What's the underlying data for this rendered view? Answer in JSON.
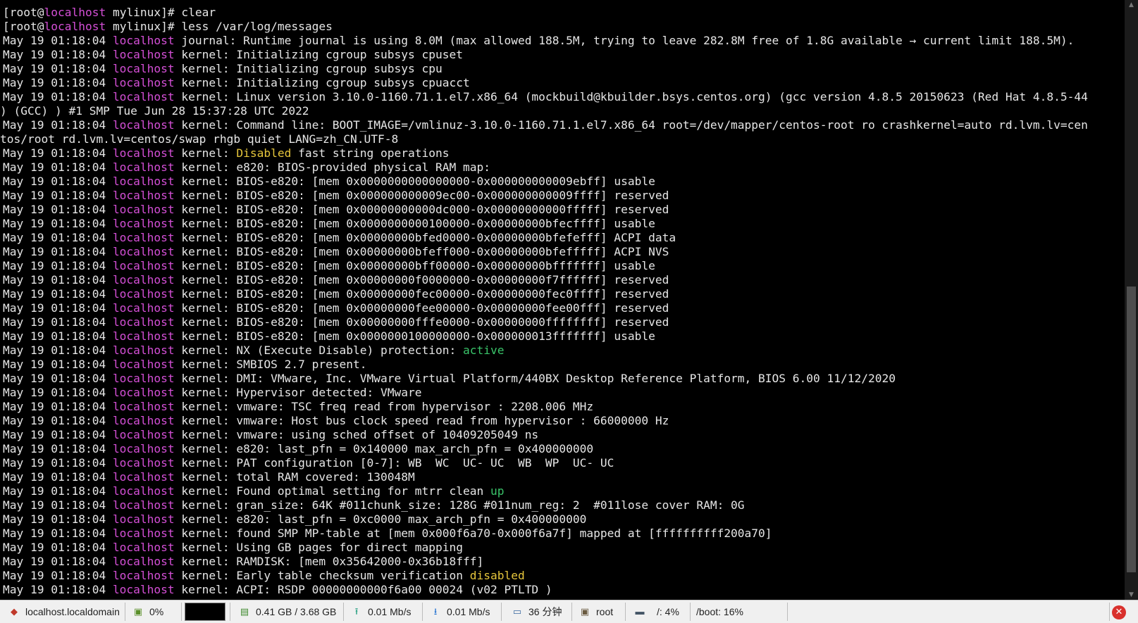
{
  "terminal": {
    "prompt_user": "[root@",
    "prompt_host": "localhost",
    "prompt_dir": " mylinux]# ",
    "cmd1": "clear",
    "cmd2": "less /var/log/messages",
    "ts": "May 19 01:18:04 ",
    "host": "localhost",
    "lines": [
      [
        "journal: Runtime journal is using 8.0M (max ",
        "allowed",
        " 188.5M, trying to leave 282.8M free of 1.8G available → current limit 188.5M)."
      ],
      [
        "kernel: Initializing cgroup subsys cpuset"
      ],
      [
        "kernel: Initializing cgroup subsys cpu"
      ],
      [
        "kernel: Initializing cgroup subsys cpuacct"
      ],
      [
        "kernel: Linux version 3.10.0-1160.71.1.el7.x86_64 (mockbuild@kbuilder.bsys.centos.org) (gcc version 4.8.5 20150623 (Red Hat 4.8.5-44"
      ],
      [
        "kernel: Command line: BOOT_IMAGE=/vmlinuz-3.10.0-1160.71.1.el7.x86_64 root=/dev/mapper/centos-root ro crashkernel=auto rd.lvm.lv=cen"
      ],
      [
        "kernel: ",
        "Disabled",
        " fast string operations"
      ],
      [
        "kernel: e820: BIOS-provided physical RAM map:"
      ],
      [
        "kernel: BIOS-e820: [mem 0x0000000000000000-0x000000000009ebff] usable"
      ],
      [
        "kernel: BIOS-e820: [mem 0x000000000009ec00-0x000000000009ffff] reserved"
      ],
      [
        "kernel: BIOS-e820: [mem 0x00000000000dc000-0x00000000000fffff] reserved"
      ],
      [
        "kernel: BIOS-e820: [mem 0x0000000000100000-0x00000000bfecffff] usable"
      ],
      [
        "kernel: BIOS-e820: [mem 0x00000000bfed0000-0x00000000bfefefff] ACPI data"
      ],
      [
        "kernel: BIOS-e820: [mem 0x00000000bfeff000-0x00000000bfefffff] ACPI NVS"
      ],
      [
        "kernel: BIOS-e820: [mem 0x00000000bff00000-0x00000000bfffffff] usable"
      ],
      [
        "kernel: BIOS-e820: [mem 0x00000000f0000000-0x00000000f7ffffff] reserved"
      ],
      [
        "kernel: BIOS-e820: [mem 0x00000000fec00000-0x00000000fec0ffff] reserved"
      ],
      [
        "kernel: BIOS-e820: [mem 0x00000000fee00000-0x00000000fee00fff] reserved"
      ],
      [
        "kernel: BIOS-e820: [mem 0x00000000fffe0000-0x00000000ffffffff] reserved"
      ],
      [
        "kernel: BIOS-e820: [mem 0x0000000100000000-0x000000013fffffff] usable"
      ],
      [
        "kernel: NX (Execute Disable) protection: ",
        "active",
        ""
      ],
      [
        "kernel: SMBIOS 2.7 present."
      ],
      [
        "kernel: DMI: VMware, Inc. VMware Virtual Platform/440BX Desktop Reference Platform, BIOS 6.00 11/12/2020"
      ],
      [
        "kernel: Hypervisor detected: VMware"
      ],
      [
        "kernel: vmware: TSC freq read from hypervisor : 2208.006 MHz"
      ],
      [
        "kernel: vmware: Host bus clock speed read from hypervisor : 66000000 Hz"
      ],
      [
        "kernel: vmware: using sched offset of 10409205049 ns"
      ],
      [
        "kernel: e820: last_pfn = 0x140000 max_arch_pfn = 0x400000000"
      ],
      [
        "kernel: PAT configuration [0-7]: WB  WC  UC- UC  WB  WP  UC- UC"
      ],
      [
        "kernel: total RAM covered: 130048M"
      ],
      [
        "kernel: Found optimal setting for mtrr clean ",
        "up",
        ""
      ],
      [
        "kernel: gran_size: 64K #011chunk_size: 128G #011num_reg: 2  #011lose cover RAM: 0G"
      ],
      [
        "kernel: e820: last_pfn = 0xc0000 max_arch_pfn = 0x400000000"
      ],
      [
        "kernel: found SMP MP-table at [mem 0x000f6a70-0x000f6a7f] mapped at [ffffffffff200a70]"
      ],
      [
        "kernel: Using GB pages for direct mapping"
      ],
      [
        "kernel: RAMDISK: [mem 0x35642000-0x36b18fff]"
      ],
      [
        "kernel: Early table checksum verification ",
        "disabled",
        ""
      ],
      [
        "kernel: ACPI: RSDP 00000000000f6a00 00024 (v02 PTLTD )"
      ]
    ],
    "wrap_lines": {
      "4": ") (GCC) ) #1 SMP Tue Jun 28 15:37:28 UTC 2022",
      "5": "tos/root rd.lvm.lv=centos/swap rhgb quiet LANG=zh_CN.UTF-8"
    },
    "highlight_colors": {
      "1": "green",
      "6": "yellow",
      "20": "green",
      "30": "green",
      "36": "yellow"
    }
  },
  "statusbar": {
    "hostname": "localhost.localdomain",
    "cpu": "0%",
    "memory": "0.41 GB / 3.68 GB",
    "upload": "0.01 Mb/s",
    "download": "0.01 Mb/s",
    "uptime": "36 分钟",
    "user": "root",
    "disk_root": "/: 4%",
    "disk_boot": "/boot: 16%",
    "cpu_progress": 0.0
  }
}
